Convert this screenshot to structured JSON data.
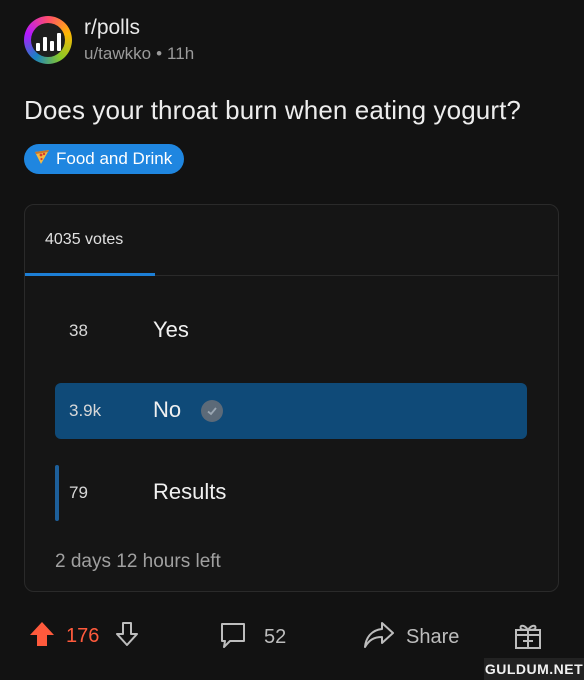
{
  "post": {
    "subreddit": "r/polls",
    "author": "u/tawkko",
    "time": "11h",
    "title": "Does your throat burn when eating yogurt?",
    "flair": "Food and Drink"
  },
  "poll": {
    "total_votes": "4035 votes",
    "options": [
      {
        "count": "38",
        "label": "Yes"
      },
      {
        "count": "3.9k",
        "label": "No"
      },
      {
        "count": "79",
        "label": "Results"
      }
    ],
    "time_left": "2 days 12 hours left"
  },
  "actions": {
    "upvotes": "176",
    "comments": "52",
    "share_label": "Share"
  },
  "watermark": "GULDUM.NET",
  "colors": {
    "accent": "#1f86e0",
    "upvote": "#ff5a3c",
    "selected_option": "#0f4a78",
    "background": "#121212"
  },
  "icons": [
    "subreddit-avatar-icon",
    "pizza-icon",
    "checkmark-icon",
    "upvote-icon",
    "downvote-icon",
    "comment-icon",
    "share-icon",
    "award-icon"
  ]
}
